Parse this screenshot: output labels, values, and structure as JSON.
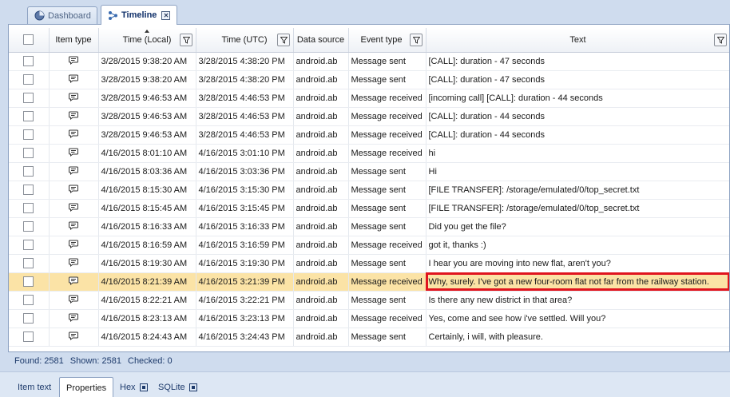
{
  "tabs": [
    {
      "label": "Dashboard"
    },
    {
      "label": "Timeline",
      "close": "✕"
    }
  ],
  "columns": {
    "item_type": "Item type",
    "time_local": "Time (Local)",
    "time_utc": "Time (UTC)",
    "data_source": "Data source",
    "event_type": "Event type",
    "text": "Text"
  },
  "rows": [
    {
      "local": "3/28/2015 9:38:20 AM",
      "utc": "3/28/2015 4:38:20 PM",
      "source": "android.ab",
      "event": "Message sent",
      "text": "[CALL]: duration - 47 seconds"
    },
    {
      "local": "3/28/2015 9:38:20 AM",
      "utc": "3/28/2015 4:38:20 PM",
      "source": "android.ab",
      "event": "Message sent",
      "text": "[CALL]: duration - 47 seconds"
    },
    {
      "local": "3/28/2015 9:46:53 AM",
      "utc": "3/28/2015 4:46:53 PM",
      "source": "android.ab",
      "event": "Message received",
      "text": "[incoming call] [CALL]: duration - 44 seconds"
    },
    {
      "local": "3/28/2015 9:46:53 AM",
      "utc": "3/28/2015 4:46:53 PM",
      "source": "android.ab",
      "event": "Message received",
      "text": "[CALL]: duration - 44 seconds"
    },
    {
      "local": "3/28/2015 9:46:53 AM",
      "utc": "3/28/2015 4:46:53 PM",
      "source": "android.ab",
      "event": "Message received",
      "text": "[CALL]: duration - 44 seconds"
    },
    {
      "local": "4/16/2015 8:01:10 AM",
      "utc": "4/16/2015 3:01:10 PM",
      "source": "android.ab",
      "event": "Message received",
      "text": "hi"
    },
    {
      "local": "4/16/2015 8:03:36 AM",
      "utc": "4/16/2015 3:03:36 PM",
      "source": "android.ab",
      "event": "Message sent",
      "text": "Hi"
    },
    {
      "local": "4/16/2015 8:15:30 AM",
      "utc": "4/16/2015 3:15:30 PM",
      "source": "android.ab",
      "event": "Message sent",
      "text": "[FILE TRANSFER]: /storage/emulated/0/top_secret.txt"
    },
    {
      "local": "4/16/2015 8:15:45 AM",
      "utc": "4/16/2015 3:15:45 PM",
      "source": "android.ab",
      "event": "Message sent",
      "text": "[FILE TRANSFER]: /storage/emulated/0/top_secret.txt"
    },
    {
      "local": "4/16/2015 8:16:33 AM",
      "utc": "4/16/2015 3:16:33 PM",
      "source": "android.ab",
      "event": "Message sent",
      "text": "Did you get the file?"
    },
    {
      "local": "4/16/2015 8:16:59 AM",
      "utc": "4/16/2015 3:16:59 PM",
      "source": "android.ab",
      "event": "Message received",
      "text": "got it, thanks :)"
    },
    {
      "local": "4/16/2015 8:19:30 AM",
      "utc": "4/16/2015 3:19:30 PM",
      "source": "android.ab",
      "event": "Message sent",
      "text": "I hear you are moving into new flat, aren't you?"
    },
    {
      "local": "4/16/2015 8:21:39 AM",
      "utc": "4/16/2015 3:21:39 PM",
      "source": "android.ab",
      "event": "Message received",
      "text": "Why, surely. I've got a new four-room flat not far from the railway station."
    },
    {
      "local": "4/16/2015 8:22:21 AM",
      "utc": "4/16/2015 3:22:21 PM",
      "source": "android.ab",
      "event": "Message sent",
      "text": "Is there any new district in that area?"
    },
    {
      "local": "4/16/2015 8:23:13 AM",
      "utc": "4/16/2015 3:23:13 PM",
      "source": "android.ab",
      "event": "Message received",
      "text": "Yes, come and see how i've settled. Will you?"
    },
    {
      "local": "4/16/2015 8:24:43 AM",
      "utc": "4/16/2015 3:24:43 PM",
      "source": "android.ab",
      "event": "Message sent",
      "text": "Certainly, i will, with pleasure."
    }
  ],
  "status": {
    "found": "Found: 2581",
    "shown": "Shown: 2581",
    "checked": "Checked: 0"
  },
  "bottom_tabs": [
    {
      "label": "Item text"
    },
    {
      "label": "Properties"
    },
    {
      "label": "Hex"
    },
    {
      "label": "SQLite"
    }
  ],
  "colors": {
    "selected_row": "#fbe3a6",
    "highlight_border": "#e0141e",
    "accent": "#10306a"
  },
  "icons": {
    "row_item_type": "message-icon",
    "column_filter": "funnel-icon",
    "dashboard_tab": "pie-chart-icon",
    "timeline_tab": "timeline-icon"
  }
}
